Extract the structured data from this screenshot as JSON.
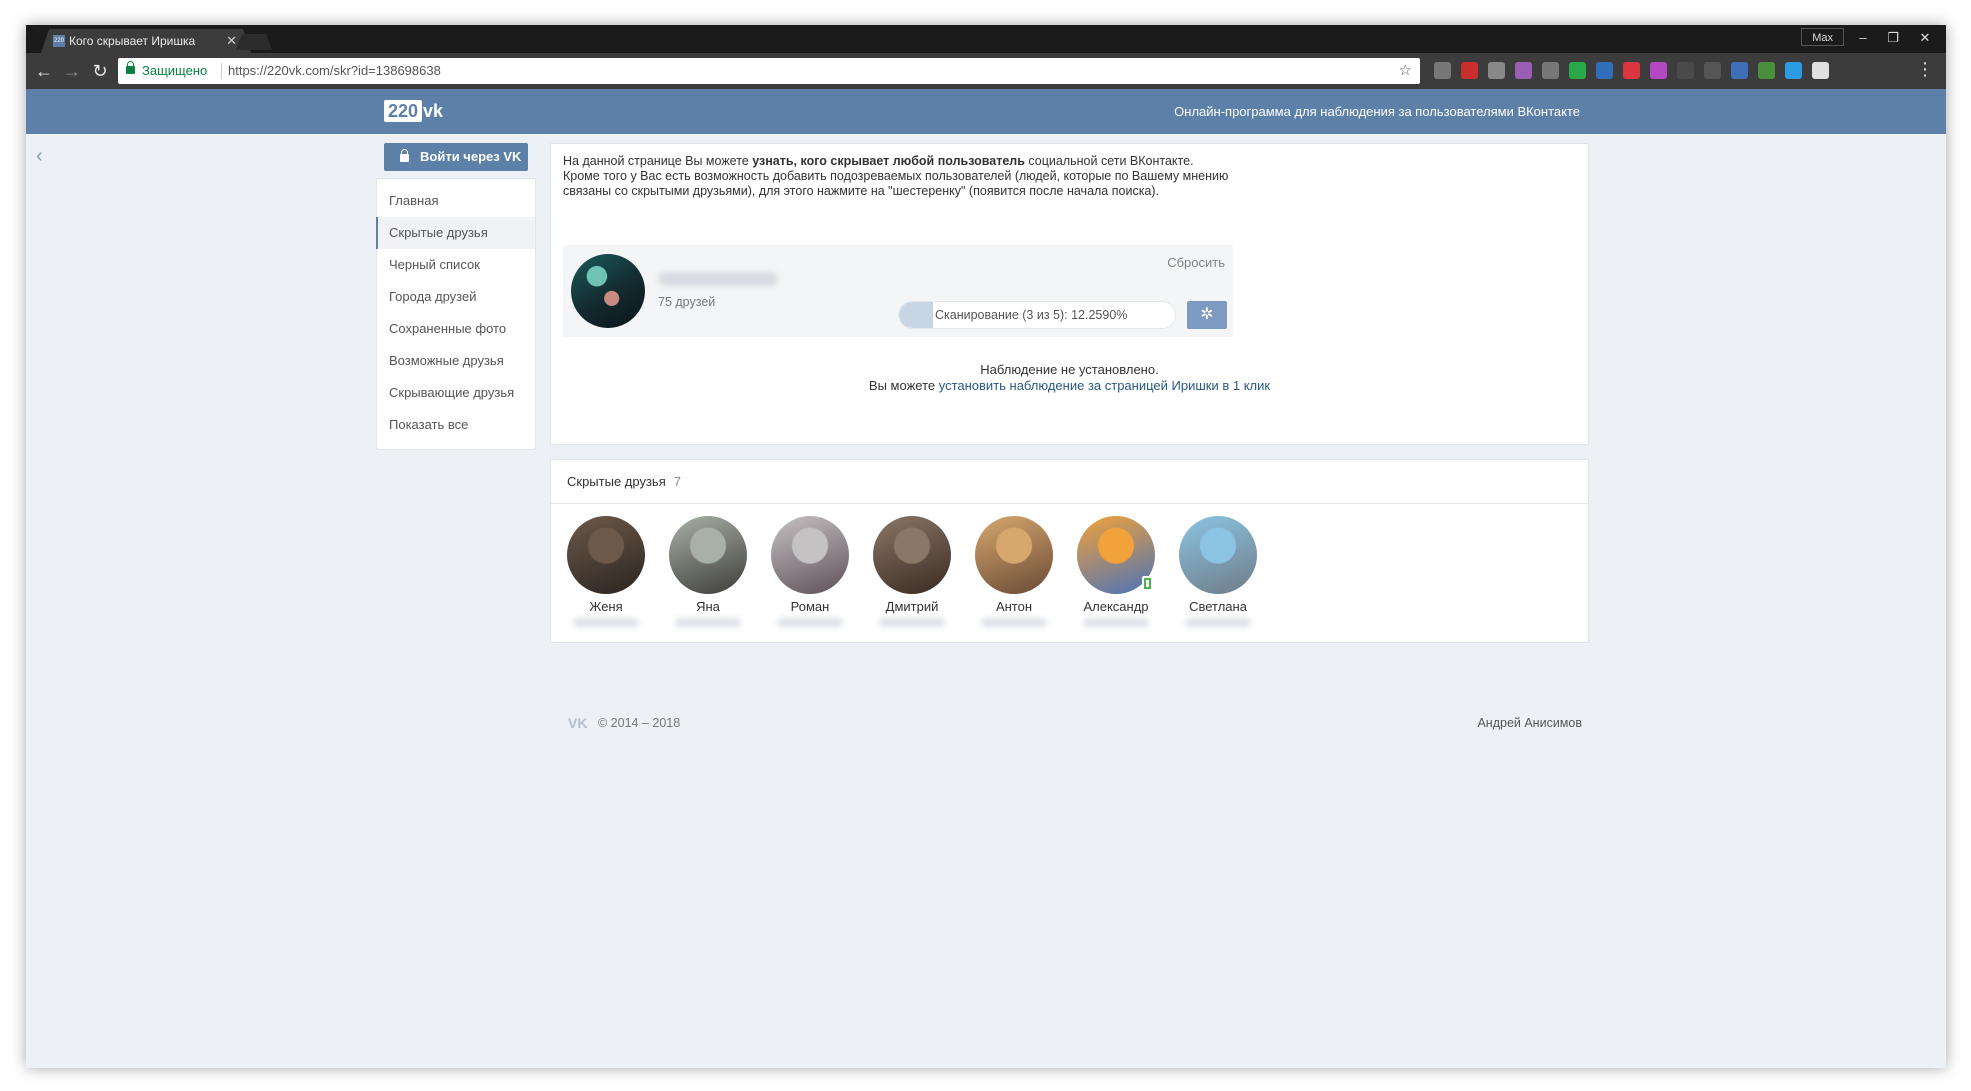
{
  "browser": {
    "tab_title": "Кого скрывает Иришка",
    "tab_favicon": "220",
    "tab_close": "✕",
    "user_badge": "Max",
    "window_controls": {
      "minimize": "–",
      "restore": "❐",
      "close": "✕"
    },
    "nav": {
      "back": "←",
      "forward": "→",
      "reload": "↻"
    },
    "secure_label": "Защищено",
    "url": "https://220vk.com/skr?id=138698638",
    "bookmark_star": "☆",
    "menu": "⋮",
    "extensions": [
      "#777",
      "#c9302c",
      "#888",
      "#9a5fb5",
      "#777",
      "#2ba84a",
      "#2f6fb8",
      "#d9363e",
      "#b348c0",
      "#4a4a4a",
      "#555",
      "#3e6fb8",
      "#4a8f3c",
      "#2c9be3",
      "#e0e0e0"
    ]
  },
  "site": {
    "logo_number": "220",
    "logo_text": "vk",
    "tagline": "Онлайн-программа для наблюдения за пользователями ВКонтакте",
    "back": "‹",
    "accent": "#5d80a8"
  },
  "sidebar": {
    "login_button": "Войти через VK",
    "items": [
      {
        "label": "Главная"
      },
      {
        "label": "Скрытые друзья"
      },
      {
        "label": "Черный список"
      },
      {
        "label": "Города друзей"
      },
      {
        "label": "Сохраненные фото"
      },
      {
        "label": "Возможные друзья"
      },
      {
        "label": "Скрывающие друзья"
      },
      {
        "label": "Показать все"
      }
    ],
    "active_index": 1
  },
  "main": {
    "intro_1": "На данной странице Вы можете ",
    "intro_bold": "узнать, кого скрывает любой пользователь",
    "intro_2": " социальной сети ВКонтакте.",
    "intro_3": "Кроме того у Вас есть возможность добавить подозреваемых пользователей (людей, которые по Вашему мнению связаны со скрытыми друзьями), для этого нажмите на \"шестеренку\" (появится после начала поиска).",
    "profile": {
      "friends_count": "75 друзей",
      "reset": "Сбросить",
      "scan_text": "Сканирование (3 из 5): 12.2590%",
      "scan_progress": 0.1226,
      "gear": "✲"
    },
    "monitor_line1": "Наблюдение не установлено.",
    "monitor_line2_prefix": "Вы можете ",
    "monitor_line2_link": "установить наблюдение за страницей Иришки в 1 клик"
  },
  "hidden_friends": {
    "title": "Скрытые друзья",
    "count": "7",
    "friends": [
      {
        "name": "Женя",
        "avatar": [
          "#6d5a4a",
          "#2b2420"
        ]
      },
      {
        "name": "Яна",
        "avatar": [
          "#a9b1a6",
          "#3e3d3a"
        ]
      },
      {
        "name": "Роман",
        "avatar": [
          "#c6c2c4",
          "#5e5057"
        ]
      },
      {
        "name": "Дмитрий",
        "avatar": [
          "#8a7767",
          "#3a2a22"
        ]
      },
      {
        "name": "Антон",
        "avatar": [
          "#d7a86e",
          "#6a4a36"
        ]
      },
      {
        "name": "Александр",
        "avatar": [
          "#f2a23a",
          "#4b72b8"
        ],
        "online_mobile": true
      },
      {
        "name": "Светлана",
        "avatar": [
          "#8cc4e4",
          "#6e7c86"
        ]
      }
    ]
  },
  "footer": {
    "vk_logo": "VK",
    "copyright": "© 2014 – 2018",
    "author": "Андрей Анисимов"
  }
}
